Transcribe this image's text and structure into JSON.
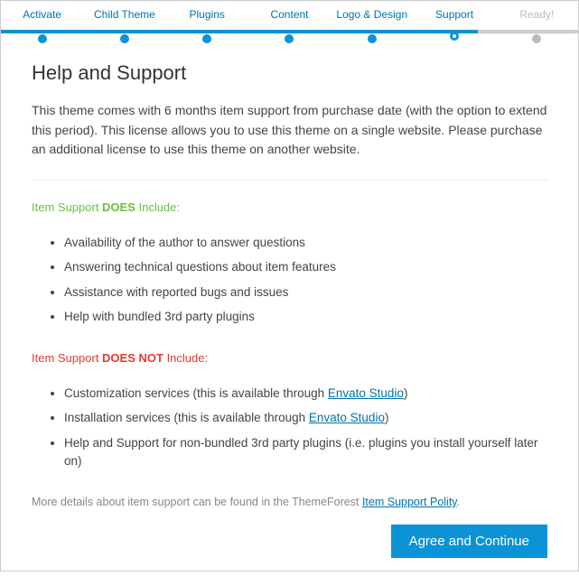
{
  "steps": [
    {
      "label": "Activate"
    },
    {
      "label": "Child Theme"
    },
    {
      "label": "Plugins"
    },
    {
      "label": "Content"
    },
    {
      "label": "Logo & Design"
    },
    {
      "label": "Support"
    },
    {
      "label": "Ready!"
    }
  ],
  "page": {
    "title": "Help and Support",
    "intro": "This theme comes with 6 months item support from purchase date (with the option to extend this period). This license allows you to use this theme on a single website. Please purchase an additional license to use this theme on another website."
  },
  "does": {
    "head_pre": "Item Support ",
    "head_b": "DOES",
    "head_post": " Include:",
    "items": [
      "Availability of the author to answer questions",
      "Answering technical questions about item features",
      "Assistance with reported bugs and issues",
      "Help with bundled 3rd party plugins"
    ]
  },
  "doesnot": {
    "head_pre": "Item Support ",
    "head_b": "DOES NOT",
    "head_post": " Include:",
    "items": [
      {
        "pre": "Customization services (this is available through ",
        "link": "Envato Studio",
        "post": ")"
      },
      {
        "pre": "Installation services (this is available through ",
        "link": "Envato Studio",
        "post": ")"
      },
      {
        "pre": "Help and Support for non-bundled 3rd party plugins (i.e. plugins you install yourself later on)",
        "link": "",
        "post": ""
      }
    ]
  },
  "more": {
    "pre": "More details about item support can be found in the ThemeForest ",
    "link": "Item Support Polity",
    "post": "."
  },
  "actions": {
    "continue": "Agree and Continue"
  }
}
